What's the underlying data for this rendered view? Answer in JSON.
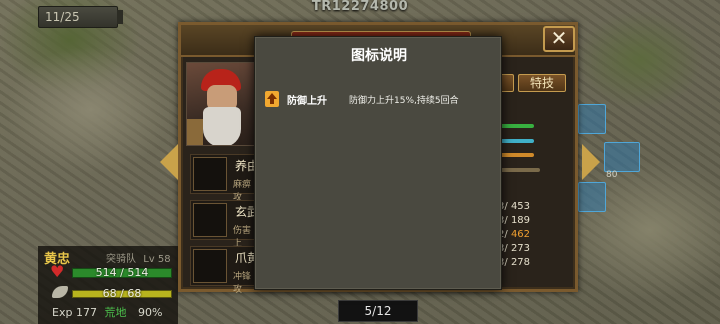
{
  "header": {
    "code": "TR12274800",
    "turn": "11/25"
  },
  "window": {
    "title": "",
    "close_label": "✕",
    "tab_label": "特技"
  },
  "skills": [
    {
      "name": "养由",
      "desc": "麻痹攻"
    },
    {
      "name": "玄武",
      "desc": "伤害上"
    },
    {
      "name": "爪黄",
      "desc": "冲锋攻"
    }
  ],
  "stats": [
    {
      "prefix": "3",
      "value": "453"
    },
    {
      "prefix": "3",
      "value": "189"
    },
    {
      "prefix": "2",
      "value": "462"
    },
    {
      "prefix": "3",
      "value": "273"
    },
    {
      "prefix": "3",
      "value": "278"
    }
  ],
  "side_tile_text": "80",
  "hero": {
    "name": "黄忠",
    "unit": "突骑队",
    "level": "Lv 58",
    "hp": "514 / 514",
    "mp": "68 / 68",
    "exp_label": "Exp",
    "exp_value": "177",
    "terrain": "荒地",
    "terrain_pct": "90%"
  },
  "page_indicator": "5/12",
  "dialog": {
    "title": "图标说明",
    "legend": [
      {
        "icon": "arrow-up-icon",
        "name": "防御上升",
        "desc": "防御力上升15%,持续5回合"
      }
    ]
  },
  "colors": {
    "highlight_stat": "#f0a030",
    "terrain": "#4cc04c",
    "hero_name": "#e8c64a"
  }
}
